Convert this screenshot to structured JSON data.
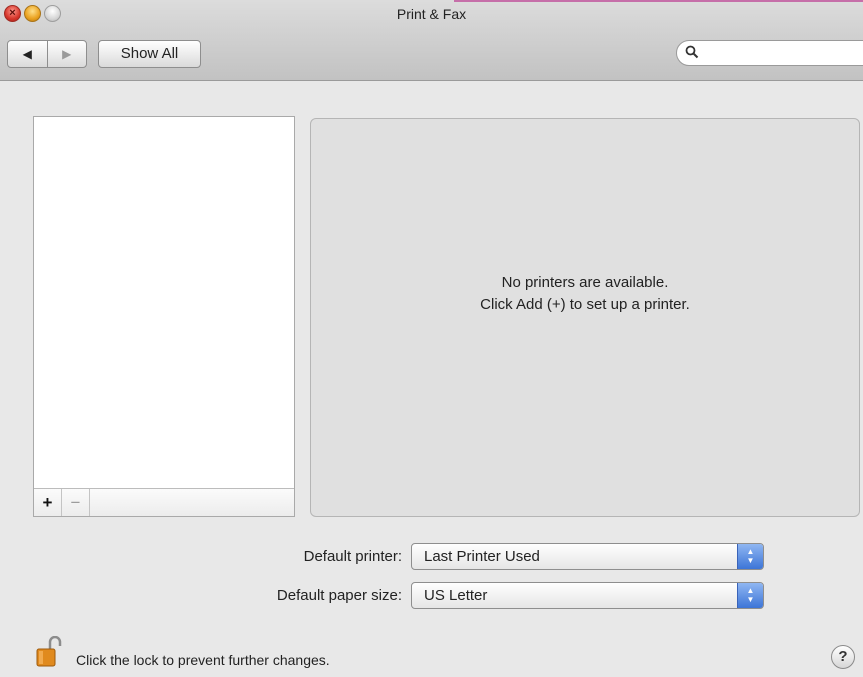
{
  "window": {
    "title": "Print & Fax"
  },
  "toolbar": {
    "back_icon": "◀",
    "forward_icon": "▶",
    "show_all_label": "Show All",
    "search_icon": "🔍",
    "search_value": "",
    "search_placeholder": ""
  },
  "printer_list": {
    "add_label": "+",
    "remove_label": "−"
  },
  "details": {
    "line1": "No printers are available.",
    "line2": "Click Add (+) to set up a printer."
  },
  "defaults": {
    "printer_label": "Default printer:",
    "printer_value": "Last Printer Used",
    "paper_label": "Default paper size:",
    "paper_value": "US Letter"
  },
  "footer": {
    "lock_text": "Click the lock to prevent further changes.",
    "help_label": "?"
  },
  "colors": {
    "accent_blue": "#3d75d7",
    "lock_orange": "#e08a1e"
  }
}
